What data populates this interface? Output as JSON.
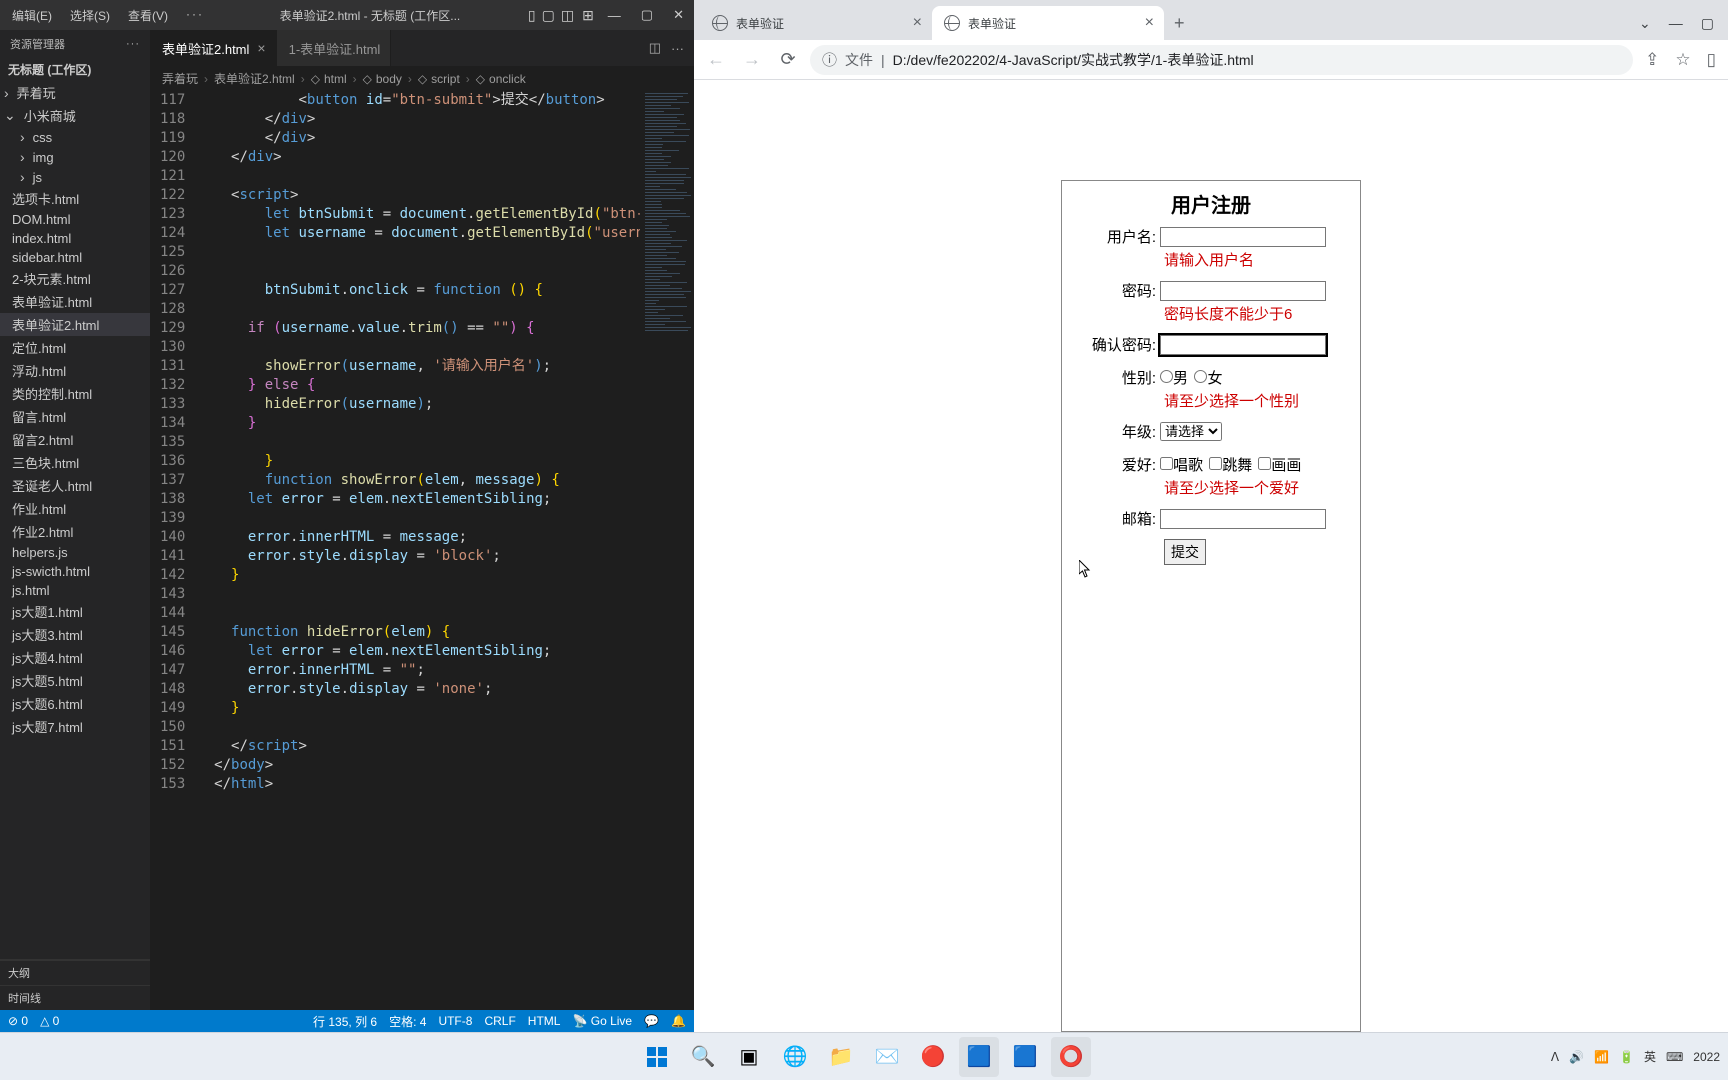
{
  "vscode": {
    "menu": [
      "编辑(E)",
      "选择(S)",
      "查看(V)"
    ],
    "windowTitle": "表单验证2.html - 无标题 (工作区...",
    "explorer": {
      "header": "资源管理器",
      "workspace": "无标题 (工作区)",
      "rootFolders": [
        "弄着玩",
        "小米商城"
      ],
      "subFolders": [
        "css",
        "img",
        "js"
      ],
      "files": [
        "选项卡.html",
        "DOM.html",
        "index.html",
        "sidebar.html",
        "2-块元素.html",
        "表单验证.html",
        "表单验证2.html",
        "定位.html",
        "浮动.html",
        "类的控制.html",
        "留言.html",
        "留言2.html",
        "三色块.html",
        "圣诞老人.html",
        "作业.html",
        "作业2.html",
        "helpers.js",
        "js-swicth.html",
        "js.html",
        "js大题1.html",
        "js大题3.html",
        "js大题4.html",
        "js大题5.html",
        "js大题6.html",
        "js大题7.html"
      ],
      "activeFile": "表单验证2.html",
      "footerSections": [
        "大纲",
        "时间线"
      ]
    },
    "tabs": [
      "表单验证2.html",
      "1-表单验证.html"
    ],
    "activeTab": 0,
    "breadcrumb": [
      "弄着玩",
      "表单验证2.html",
      "html",
      "body",
      "script",
      "onclick"
    ],
    "statusbar": {
      "errors": "⊘ 0",
      "warnings": "△ 0",
      "position": "行 135, 列 6",
      "spaces": "空格: 4",
      "encoding": "UTF-8",
      "eol": "CRLF",
      "lang": "HTML",
      "goLive": "Go Live"
    }
  },
  "chrome": {
    "tabs": [
      "表单验证",
      "表单验证"
    ],
    "activeTab": 1,
    "urlProto": "文件",
    "urlPath": "D:/dev/fe202202/4-JavaScript/实战式教学/1-表单验证.html"
  },
  "form": {
    "title": "用户注册",
    "usernameLabel": "用户名:",
    "usernameError": "请输入用户名",
    "passwordLabel": "密码:",
    "passwordError": "密码长度不能少于6",
    "confirmLabel": "确认密码:",
    "genderLabel": "性别:",
    "genderMale": "男",
    "genderFemale": "女",
    "genderError": "请至少选择一个性别",
    "gradeLabel": "年级:",
    "gradeOptions": [
      "请选择"
    ],
    "hobbyLabel": "爱好:",
    "hobbies": [
      "唱歌",
      "跳舞",
      "画画"
    ],
    "hobbyError": "请至少选择一个爱好",
    "emailLabel": "邮箱:",
    "submitLabel": "提交"
  },
  "taskbar": {
    "tray": {
      "up": "ᐱ",
      "ime1": "英",
      "ime2": "⌨",
      "clockYear": "2022"
    }
  },
  "code": {
    "lineStart": 117,
    "lines": [
      {
        "i": "            ",
        "t": [
          [
            "<",
            "pn"
          ],
          [
            "button",
            "tag"
          ],
          [
            " id",
            "attr"
          ],
          [
            "=",
            "pn"
          ],
          [
            "\"btn-submit\"",
            "str"
          ],
          [
            ">",
            "pn"
          ],
          [
            "提交",
            ""
          ],
          [
            "</",
            "pn"
          ],
          [
            "button",
            "tag"
          ],
          [
            ">",
            "pn"
          ]
        ]
      },
      {
        "i": "        ",
        "t": [
          [
            "</",
            "pn"
          ],
          [
            "div",
            "tag"
          ],
          [
            ">",
            "pn"
          ]
        ]
      },
      {
        "i": "        ",
        "t": [
          [
            "</",
            "pn"
          ],
          [
            "div",
            "tag"
          ],
          [
            ">",
            "pn"
          ]
        ]
      },
      {
        "i": "    ",
        "t": [
          [
            "</",
            "pn"
          ],
          [
            "div",
            "tag"
          ],
          [
            ">",
            "pn"
          ]
        ]
      },
      {
        "i": "",
        "t": []
      },
      {
        "i": "    ",
        "t": [
          [
            "<",
            "pn"
          ],
          [
            "script",
            "tag"
          ],
          [
            ">",
            "pn"
          ]
        ]
      },
      {
        "i": "        ",
        "t": [
          [
            "let",
            "kw"
          ],
          [
            " btnSubmit ",
            "id"
          ],
          [
            "= ",
            "op"
          ],
          [
            "document",
            "id"
          ],
          [
            ".",
            ""
          ],
          [
            "getElementById",
            "fn"
          ],
          [
            "(",
            "brace-y"
          ],
          [
            "\"btn-su",
            "str"
          ]
        ]
      },
      {
        "i": "        ",
        "t": [
          [
            "let",
            "kw"
          ],
          [
            " username ",
            "id"
          ],
          [
            "= ",
            "op"
          ],
          [
            "document",
            "id"
          ],
          [
            ".",
            ""
          ],
          [
            "getElementById",
            "fn"
          ],
          [
            "(",
            "brace-y"
          ],
          [
            "\"usernam",
            "str"
          ]
        ]
      },
      {
        "i": "",
        "t": []
      },
      {
        "i": "",
        "t": []
      },
      {
        "i": "        ",
        "t": [
          [
            "btnSubmit",
            "id"
          ],
          [
            ".",
            ""
          ],
          [
            "onclick",
            "id"
          ],
          [
            " = ",
            "op"
          ],
          [
            "function",
            "kw"
          ],
          [
            " ",
            "op"
          ],
          [
            "(",
            "brace-y"
          ],
          [
            ")",
            "brace-y"
          ],
          [
            " ",
            "op"
          ],
          [
            "{",
            "brace-y"
          ]
        ]
      },
      {
        "i": "",
        "t": []
      },
      {
        "i": "      ",
        "t": [
          [
            "if",
            "kw2"
          ],
          [
            " ",
            "op"
          ],
          [
            "(",
            "brace-p"
          ],
          [
            "username",
            "id"
          ],
          [
            ".",
            ""
          ],
          [
            "value",
            "id"
          ],
          [
            ".",
            ""
          ],
          [
            "trim",
            "fn"
          ],
          [
            "(",
            "brace-b"
          ],
          [
            ")",
            "brace-b"
          ],
          [
            " == ",
            "op"
          ],
          [
            "\"\"",
            "str"
          ],
          [
            ")",
            "brace-p"
          ],
          [
            " ",
            "op"
          ],
          [
            "{",
            "brace-p"
          ]
        ]
      },
      {
        "i": "",
        "t": []
      },
      {
        "i": "        ",
        "t": [
          [
            "showError",
            "fn"
          ],
          [
            "(",
            "brace-b"
          ],
          [
            "username",
            "id"
          ],
          [
            ", ",
            "op"
          ],
          [
            "'请输入用户名'",
            "str"
          ],
          [
            ")",
            "brace-b"
          ],
          [
            ";",
            ""
          ]
        ]
      },
      {
        "i": "      ",
        "t": [
          [
            "}",
            "brace-p"
          ],
          [
            " ",
            "op"
          ],
          [
            "else",
            "kw2"
          ],
          [
            " ",
            "op"
          ],
          [
            "{",
            "brace-p"
          ]
        ]
      },
      {
        "i": "        ",
        "t": [
          [
            "hideError",
            "fn"
          ],
          [
            "(",
            "brace-b"
          ],
          [
            "username",
            "id"
          ],
          [
            ")",
            "brace-b"
          ],
          [
            ";",
            ""
          ]
        ]
      },
      {
        "i": "      ",
        "t": [
          [
            "}",
            "brace-p"
          ]
        ]
      },
      {
        "i": "     ",
        "t": []
      },
      {
        "i": "        ",
        "t": [
          [
            "}",
            "brace-y"
          ]
        ]
      },
      {
        "i": "        ",
        "t": [
          [
            "function",
            "kw"
          ],
          [
            " ",
            "op"
          ],
          [
            "showError",
            "fn"
          ],
          [
            "(",
            "brace-y"
          ],
          [
            "elem",
            "id"
          ],
          [
            ", ",
            "op"
          ],
          [
            "message",
            "id"
          ],
          [
            ")",
            "brace-y"
          ],
          [
            " ",
            "op"
          ],
          [
            "{",
            "brace-y"
          ]
        ]
      },
      {
        "i": "      ",
        "t": [
          [
            "let",
            "kw"
          ],
          [
            " error ",
            "id"
          ],
          [
            "= ",
            "op"
          ],
          [
            "elem",
            "id"
          ],
          [
            ".",
            ""
          ],
          [
            "nextElementSibling",
            "id"
          ],
          [
            ";",
            ""
          ]
        ]
      },
      {
        "i": "",
        "t": []
      },
      {
        "i": "      ",
        "t": [
          [
            "error",
            "id"
          ],
          [
            ".",
            ""
          ],
          [
            "innerHTML",
            "id"
          ],
          [
            " = ",
            "op"
          ],
          [
            "message",
            "id"
          ],
          [
            ";",
            ""
          ]
        ]
      },
      {
        "i": "      ",
        "t": [
          [
            "error",
            "id"
          ],
          [
            ".",
            ""
          ],
          [
            "style",
            "id"
          ],
          [
            ".",
            ""
          ],
          [
            "display",
            "id"
          ],
          [
            " = ",
            "op"
          ],
          [
            "'block'",
            "str"
          ],
          [
            ";",
            ""
          ]
        ]
      },
      {
        "i": "    ",
        "t": [
          [
            "}",
            "brace-y"
          ]
        ]
      },
      {
        "i": "",
        "t": []
      },
      {
        "i": "",
        "t": []
      },
      {
        "i": "    ",
        "t": [
          [
            "function",
            "kw"
          ],
          [
            " ",
            "op"
          ],
          [
            "hideError",
            "fn"
          ],
          [
            "(",
            "brace-y"
          ],
          [
            "elem",
            "id"
          ],
          [
            ")",
            "brace-y"
          ],
          [
            " ",
            "op"
          ],
          [
            "{",
            "brace-y"
          ]
        ]
      },
      {
        "i": "      ",
        "t": [
          [
            "let",
            "kw"
          ],
          [
            " error ",
            "id"
          ],
          [
            "= ",
            "op"
          ],
          [
            "elem",
            "id"
          ],
          [
            ".",
            ""
          ],
          [
            "nextElementSibling",
            "id"
          ],
          [
            ";",
            ""
          ]
        ]
      },
      {
        "i": "      ",
        "t": [
          [
            "error",
            "id"
          ],
          [
            ".",
            ""
          ],
          [
            "innerHTML",
            "id"
          ],
          [
            " = ",
            "op"
          ],
          [
            "\"\"",
            "str"
          ],
          [
            ";",
            ""
          ]
        ]
      },
      {
        "i": "      ",
        "t": [
          [
            "error",
            "id"
          ],
          [
            ".",
            ""
          ],
          [
            "style",
            "id"
          ],
          [
            ".",
            ""
          ],
          [
            "display",
            "id"
          ],
          [
            " = ",
            "op"
          ],
          [
            "'none'",
            "str"
          ],
          [
            ";",
            ""
          ]
        ]
      },
      {
        "i": "    ",
        "t": [
          [
            "}",
            "brace-y"
          ]
        ]
      },
      {
        "i": "",
        "t": []
      },
      {
        "i": "    ",
        "t": [
          [
            "</",
            "pn"
          ],
          [
            "script",
            "tag"
          ],
          [
            ">",
            "pn"
          ]
        ]
      },
      {
        "i": "  ",
        "t": [
          [
            "</",
            "pn"
          ],
          [
            "body",
            "tag"
          ],
          [
            ">",
            "pn"
          ]
        ]
      },
      {
        "i": "  ",
        "t": [
          [
            "</",
            "pn"
          ],
          [
            "html",
            "tag"
          ],
          [
            ">",
            "pn"
          ]
        ]
      }
    ]
  }
}
